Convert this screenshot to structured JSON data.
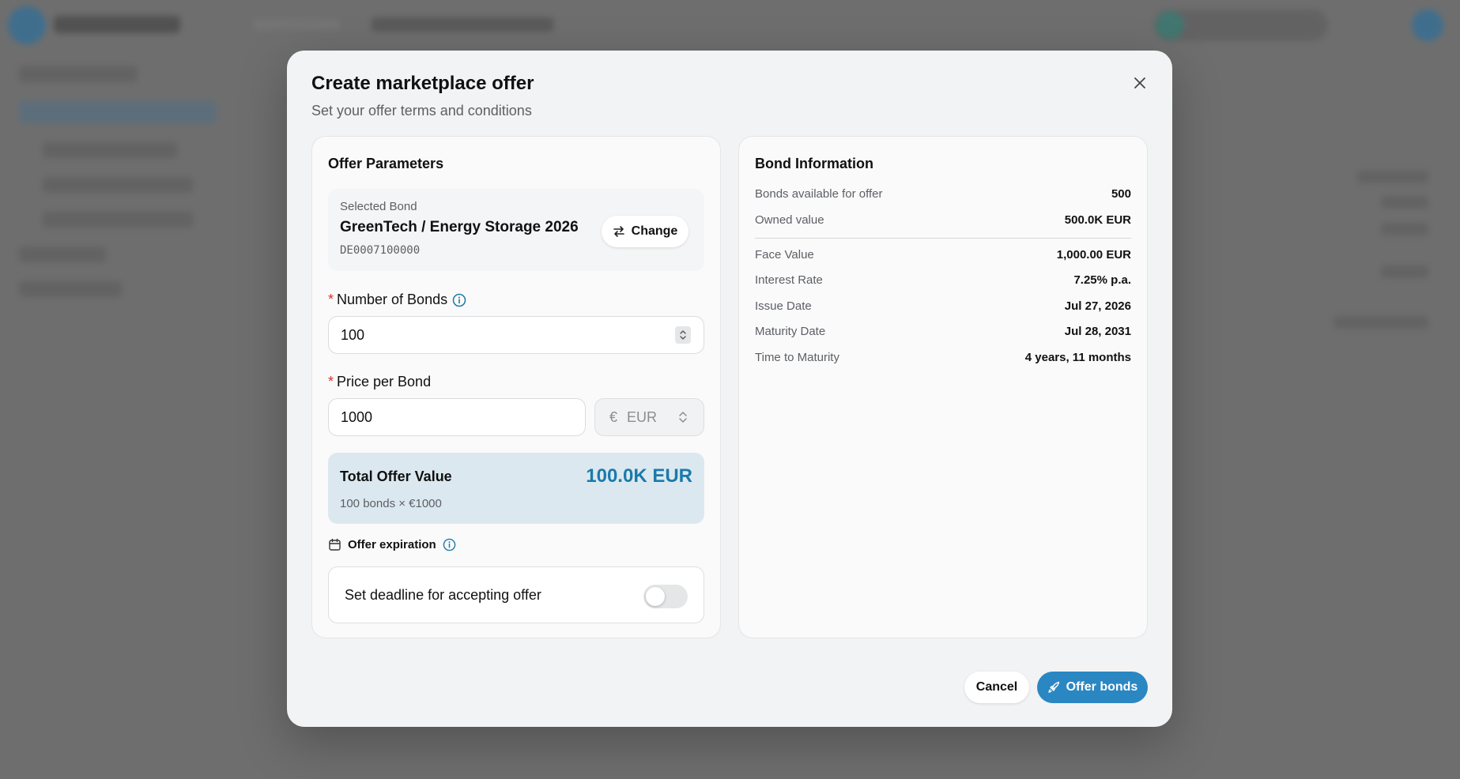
{
  "dialog": {
    "title": "Create marketplace offer",
    "subtitle": "Set your offer terms and conditions",
    "close_icon": "close-icon"
  },
  "offer_parameters": {
    "title": "Offer Parameters",
    "selected_bond": {
      "label": "Selected Bond",
      "name": "GreenTech / Energy Storage 2026",
      "isin": "DE0007100000",
      "change_label": "Change",
      "change_icon": "swap-arrows-icon"
    },
    "number_of_bonds": {
      "required_mark": "*",
      "label": "Number of Bonds",
      "value": "100"
    },
    "price_per_bond": {
      "required_mark": "*",
      "label": "Price per Bond",
      "value": "1000",
      "currency_symbol": "€",
      "currency": "EUR"
    },
    "total": {
      "label": "Total Offer Value",
      "value": "100.0K EUR",
      "formula": "100 bonds × €1000"
    },
    "expiration": {
      "label": "Offer expiration",
      "deadline_label": "Set deadline for accepting offer",
      "deadline_enabled": false
    }
  },
  "bond_information": {
    "title": "Bond Information",
    "rows": [
      {
        "key": "Bonds available for offer",
        "value": "500"
      },
      {
        "key": "Owned value",
        "value": "500.0K EUR"
      },
      {
        "key": "Face Value",
        "value": "1,000.00 EUR"
      },
      {
        "key": "Interest Rate",
        "value": "7.25% p.a."
      },
      {
        "key": "Issue Date",
        "value": "Jul 27, 2026"
      },
      {
        "key": "Maturity Date",
        "value": "Jul 28, 2031"
      },
      {
        "key": "Time to Maturity",
        "value": "4 years, 11 months"
      }
    ]
  },
  "footer": {
    "cancel_label": "Cancel",
    "offer_label": "Offer bonds",
    "offer_icon": "rocket-icon"
  },
  "colors": {
    "accent": "#2a87c2",
    "total_value": "#1b7aab",
    "total_bg": "#dce8ef",
    "required": "#d9302c"
  }
}
